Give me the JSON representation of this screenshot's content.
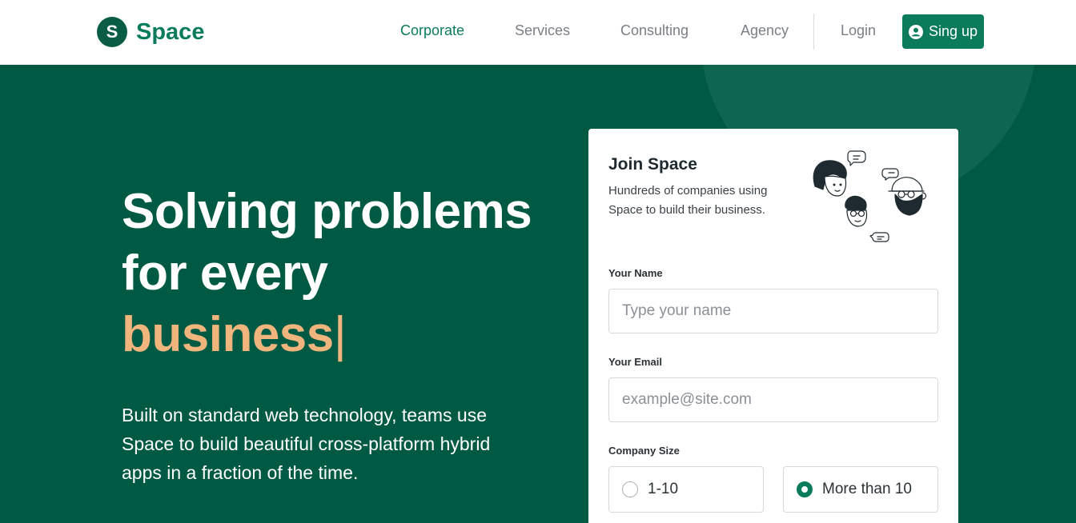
{
  "brand": {
    "logo_letter": "S",
    "name": "Space"
  },
  "nav": {
    "links": [
      "Corporate",
      "Services",
      "Consulting",
      "Agency"
    ],
    "active": "Corporate",
    "login": "Login",
    "signup": "Sing up",
    "signup_icon": "user-circle-icon"
  },
  "hero": {
    "line1": "Solving problems",
    "line2": "for every",
    "accent_word": "business",
    "cursor": "|",
    "lead": "Built on standard web technology, teams use Space to build beautiful cross-platform hybrid apps in a fraction of the time."
  },
  "card": {
    "title": "Join Space",
    "subtitle": "Hundreds of companies using Space to build their business.",
    "illustration": "people-chatting-illustration",
    "name_label": "Your Name",
    "name_placeholder": "Type your name",
    "email_label": "Your Email",
    "email_placeholder": "example@site.com",
    "size_label": "Company Size",
    "size_options": [
      "1-10",
      "More than 10"
    ],
    "size_selected": "More than 10"
  },
  "colors": {
    "brand_green": "#0a7c5c",
    "hero_bg": "#005943",
    "accent": "#f0b47d",
    "nav_text": "#7a7f85"
  }
}
